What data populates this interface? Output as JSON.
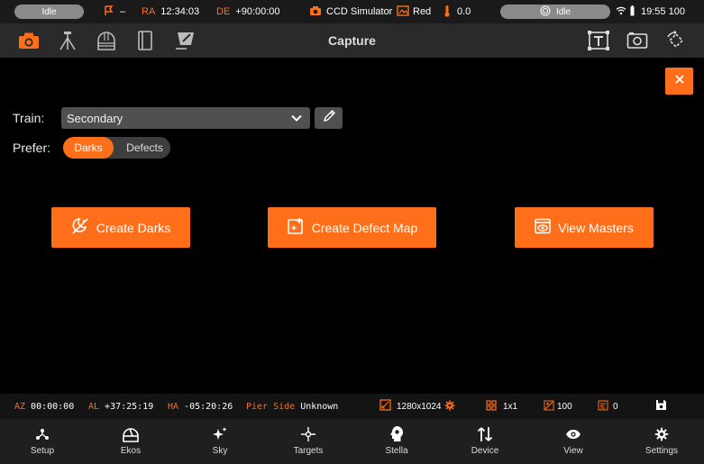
{
  "status_bar": {
    "left_status": "Idle",
    "flag_value": "–",
    "ra_label": "RA",
    "ra_value": "12:34:03",
    "de_label": "DE",
    "de_value": "+90:00:00",
    "camera_label": "CCD Simulator",
    "filter_label": "Red",
    "temperature": "0.0",
    "right_status": "Idle",
    "time_battery": "19:55 100"
  },
  "toolbar": {
    "title": "Capture",
    "icons": [
      "camera-icon",
      "tripod-icon",
      "observatory-icon",
      "notebook-icon",
      "flat-panel-icon",
      "text-frame-icon",
      "screenshot-icon",
      "rotate-icon"
    ]
  },
  "form": {
    "train_label": "Train:",
    "train_value": "Secondary",
    "prefer_label": "Prefer:",
    "prefer_options": [
      "Darks",
      "Defects"
    ],
    "prefer_selected": "Darks"
  },
  "actions": {
    "create_darks": "Create Darks",
    "create_defect_map": "Create Defect Map",
    "view_masters": "View Masters"
  },
  "info_bar": {
    "az_label": "AZ",
    "az_value": "00:00:00",
    "al_label": "AL",
    "al_value": "+37:25:19",
    "ha_label": "HA",
    "ha_value": "-05:20:26",
    "pier_label": "Pier Side",
    "pier_value": "Unknown",
    "resolution": "1280x1024",
    "binning": "1x1",
    "gain": "100",
    "offset": "0"
  },
  "bottom_nav": [
    {
      "label": "Setup"
    },
    {
      "label": "Ekos"
    },
    {
      "label": "Sky"
    },
    {
      "label": "Targets"
    },
    {
      "label": "Stella"
    },
    {
      "label": "Device"
    },
    {
      "label": "View"
    },
    {
      "label": "Settings"
    }
  ],
  "colors": {
    "accent": "#ff6f1a",
    "background": "#000000",
    "toolbar": "#2a2a2a"
  }
}
